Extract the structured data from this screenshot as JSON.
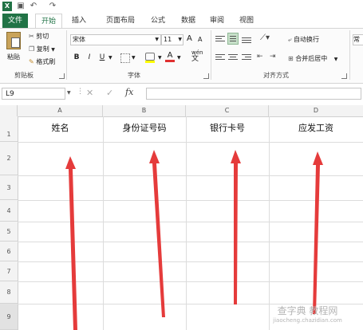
{
  "quick_access": {
    "app_icon": "excel-icon",
    "save_icon": "save-icon",
    "undo_icon": "undo-icon",
    "redo_icon": "redo-icon"
  },
  "tabs": [
    "文件",
    "开始",
    "插入",
    "页面布局",
    "公式",
    "数据",
    "审阅",
    "视图"
  ],
  "clipboard": {
    "paste": "粘贴",
    "cut": "剪切",
    "copy": "复制",
    "format_painter": "格式刷",
    "group": "剪贴板"
  },
  "font": {
    "name": "宋体",
    "size": "11",
    "bold": "B",
    "italic": "I",
    "underline": "U",
    "grow": "A",
    "shrink": "A",
    "wen": "wén",
    "color_letter": "A",
    "group": "字体"
  },
  "alignment": {
    "wrap": "自动换行",
    "merge": "合并后居中",
    "group": "对齐方式"
  },
  "number": {
    "format": "常"
  },
  "formula_bar": {
    "name_box": "L9",
    "fx": "fx",
    "cancel": "✕",
    "confirm": "✓"
  },
  "columns": [
    "A",
    "B",
    "C",
    "D"
  ],
  "rows": [
    "1",
    "2",
    "3",
    "4",
    "5",
    "6",
    "7",
    "8",
    "9"
  ],
  "headers": [
    "姓名",
    "身份证号码",
    "银行卡号",
    "应发工资"
  ],
  "watermark": {
    "line1": "查字典 教程网",
    "line2": "jiaocheng.chazidian.com"
  },
  "colors": {
    "accent": "#217346",
    "arrow": "#e53b3b"
  }
}
